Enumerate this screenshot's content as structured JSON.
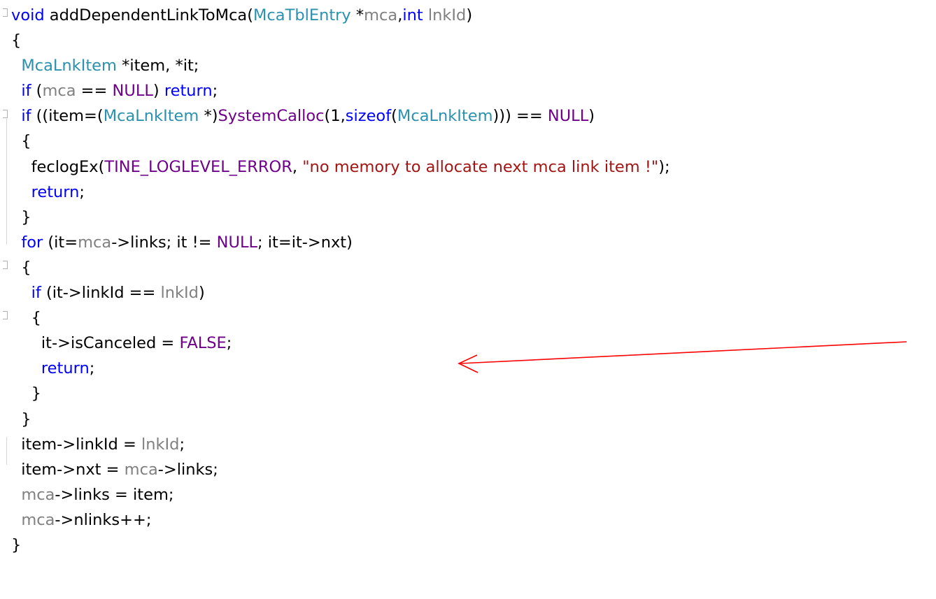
{
  "code": {
    "lines": [
      [
        {
          "t": "void",
          "c": "kw"
        },
        {
          "t": " addDependentLinkToMca("
        },
        {
          "t": "McaTblEntry",
          "c": "ty"
        },
        {
          "t": " *"
        },
        {
          "t": "mca",
          "c": "pa"
        },
        {
          "t": ","
        },
        {
          "t": "int",
          "c": "kw"
        },
        {
          "t": " "
        },
        {
          "t": "lnkId",
          "c": "pa"
        },
        {
          "t": ")"
        }
      ],
      [
        {
          "t": "{"
        }
      ],
      [
        {
          "t": "  "
        },
        {
          "t": "McaLnkItem",
          "c": "ty"
        },
        {
          "t": " *item, *it;"
        }
      ],
      [
        {
          "t": "  "
        },
        {
          "t": "if",
          "c": "kw"
        },
        {
          "t": " ("
        },
        {
          "t": "mca",
          "c": "pa"
        },
        {
          "t": " == "
        },
        {
          "t": "NULL",
          "c": "ma"
        },
        {
          "t": ") "
        },
        {
          "t": "return",
          "c": "kw"
        },
        {
          "t": ";"
        }
      ],
      [
        {
          "t": "  "
        },
        {
          "t": "if",
          "c": "kw"
        },
        {
          "t": " ((item=("
        },
        {
          "t": "McaLnkItem",
          "c": "ty"
        },
        {
          "t": " *)"
        },
        {
          "t": "SystemCalloc",
          "c": "ma"
        },
        {
          "t": "(1,"
        },
        {
          "t": "sizeof",
          "c": "kw"
        },
        {
          "t": "("
        },
        {
          "t": "McaLnkItem",
          "c": "ty"
        },
        {
          "t": "))) == "
        },
        {
          "t": "NULL",
          "c": "ma"
        },
        {
          "t": ")"
        }
      ],
      [
        {
          "t": "  {"
        }
      ],
      [
        {
          "t": "    feclogEx("
        },
        {
          "t": "TINE_LOGLEVEL_ERROR",
          "c": "ma"
        },
        {
          "t": ", "
        },
        {
          "t": "\"no memory to allocate next mca link item !\"",
          "c": "st"
        },
        {
          "t": ");"
        }
      ],
      [
        {
          "t": "    "
        },
        {
          "t": "return",
          "c": "kw"
        },
        {
          "t": ";"
        }
      ],
      [
        {
          "t": "  }"
        }
      ],
      [
        {
          "t": "  "
        },
        {
          "t": "for",
          "c": "kw"
        },
        {
          "t": " (it="
        },
        {
          "t": "mca",
          "c": "pa"
        },
        {
          "t": "->links; it != "
        },
        {
          "t": "NULL",
          "c": "ma"
        },
        {
          "t": "; it=it->nxt)"
        }
      ],
      [
        {
          "t": "  {"
        }
      ],
      [
        {
          "t": "    "
        },
        {
          "t": "if",
          "c": "kw"
        },
        {
          "t": " (it->linkId == "
        },
        {
          "t": "lnkId",
          "c": "pa"
        },
        {
          "t": ")"
        }
      ],
      [
        {
          "t": "    {"
        }
      ],
      [
        {
          "t": "      it->isCanceled = "
        },
        {
          "t": "FALSE",
          "c": "ma"
        },
        {
          "t": ";"
        }
      ],
      [
        {
          "t": "      "
        },
        {
          "t": "return",
          "c": "kw"
        },
        {
          "t": ";"
        }
      ],
      [
        {
          "t": "    }"
        }
      ],
      [
        {
          "t": "  }"
        }
      ],
      [
        {
          "t": "  item->linkId = "
        },
        {
          "t": "lnkId",
          "c": "pa"
        },
        {
          "t": ";"
        }
      ],
      [
        {
          "t": "  item->nxt = "
        },
        {
          "t": "mca",
          "c": "pa"
        },
        {
          "t": "->links;"
        }
      ],
      [
        {
          "t": "  "
        },
        {
          "t": "mca",
          "c": "pa"
        },
        {
          "t": "->links = item;"
        }
      ],
      [
        {
          "t": "  "
        },
        {
          "t": "mca",
          "c": "pa"
        },
        {
          "t": "->nlinks++;"
        }
      ],
      [
        {
          "t": "}"
        }
      ]
    ]
  },
  "colors": {
    "keyword": "#0000ff",
    "type": "#2b91af",
    "macro": "#6f008a",
    "parameter": "#808080",
    "string": "#a31515",
    "arrow": "#ff0000"
  },
  "annotation": {
    "icon": "red-arrow-pointing-left"
  }
}
